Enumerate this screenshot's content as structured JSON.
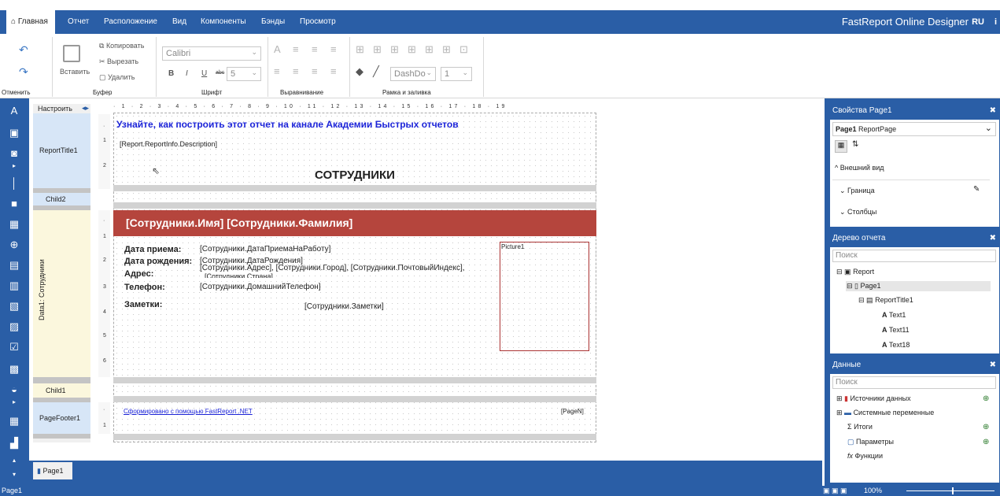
{
  "tabs": [
    {
      "label": "Главная",
      "active": true
    },
    {
      "label": "Отчет"
    },
    {
      "label": "Расположение"
    },
    {
      "label": "Вид"
    },
    {
      "label": "Компоненты"
    },
    {
      "label": "Бэнды"
    },
    {
      "label": "Просмотр"
    }
  ],
  "brand": "FastReport Online Designer",
  "lang": "RU",
  "info_icon": "i",
  "ribbon": {
    "undo": "Отменить",
    "buffer": "Буфер",
    "paste": "Вставить",
    "copy": "Копировать",
    "cut": "Вырезать",
    "delete": "Удалить",
    "font_label": "Шрифт",
    "font_name": "Calibri",
    "font_size": "5",
    "align_label": "Выравнивание",
    "frame_label": "Рамка и заливка",
    "dash": "DashDo",
    "line_width": "1",
    "bold": "B",
    "italic": "I",
    "underline": "U",
    "strike": "abc"
  },
  "bands_header": "Настроить бэнды...",
  "bands": {
    "report_title": "ReportTitle1",
    "child2": "Child2",
    "data1": "Data1: Сотрудники",
    "child1": "Child1",
    "page_footer": "PageFooter1"
  },
  "ruler": "· 1 · 2 · 3 · 4 · 5 · 6 · 7 · 8 · 9 · 10 · 11 · 12 · 13 · 14 · 15 · 16 · 17 · 18 · 19",
  "report": {
    "link_text": "Узнайте, как построить этот отчет на канале Академии Быстрых отчетов",
    "description": "[Report.ReportInfo.Description]",
    "title": "СОТРУДНИКИ",
    "header": "[Сотрудники.Имя] [Сотрудники.Фамилия]",
    "fields": [
      {
        "label": "Дата приема:",
        "value": "[Сотрудники.ДатаПриемаНаРаботу]"
      },
      {
        "label": "Дата рождения:",
        "value": "[Сотрудники.ДатаРождения]"
      },
      {
        "label": "Адрес:",
        "value": "[Сотрудники.Адрес], [Сотрудники.Город], [Сотрудники.ПочтовыйИндекс],"
      },
      {
        "label": "Телефон:",
        "value": "[Сотрудники.ДомашнийТелефон]"
      },
      {
        "label": "Заметки:",
        "value": "[Сотрудники.Заметки]"
      }
    ],
    "country": "[Сотрудники.Страна]",
    "picture": "Picture1",
    "footer_link": "Сформировано с помощью FastReport .NET",
    "page_n": "[PageN]"
  },
  "vruler": {
    "title": [
      "·",
      "1",
      "2"
    ],
    "data": [
      "·",
      "1",
      "2",
      "3",
      "4",
      "5",
      "6"
    ],
    "footer": [
      "·",
      "1"
    ]
  },
  "page_tab": "Page1",
  "properties": {
    "title": "Свойства Page1",
    "object_bold": "Page1",
    "object_type": "ReportPage",
    "sections": [
      "Внешний вид",
      "Граница",
      "Столбцы"
    ]
  },
  "tree": {
    "title": "Дерево отчета",
    "search": "Поиск",
    "items": [
      "Report",
      "Page1",
      "ReportTitle1",
      "Text1",
      "Text11",
      "Text18"
    ]
  },
  "data": {
    "title": "Данные",
    "search": "Поиск",
    "items": [
      "Источники данных",
      "Системные переменные",
      "Итоги",
      "Параметры",
      "Функции"
    ]
  },
  "status": {
    "page": "Page1",
    "zoom": "100%"
  },
  "colors": {
    "accent": "#2a5ea6",
    "header_band": "#b5453d"
  }
}
